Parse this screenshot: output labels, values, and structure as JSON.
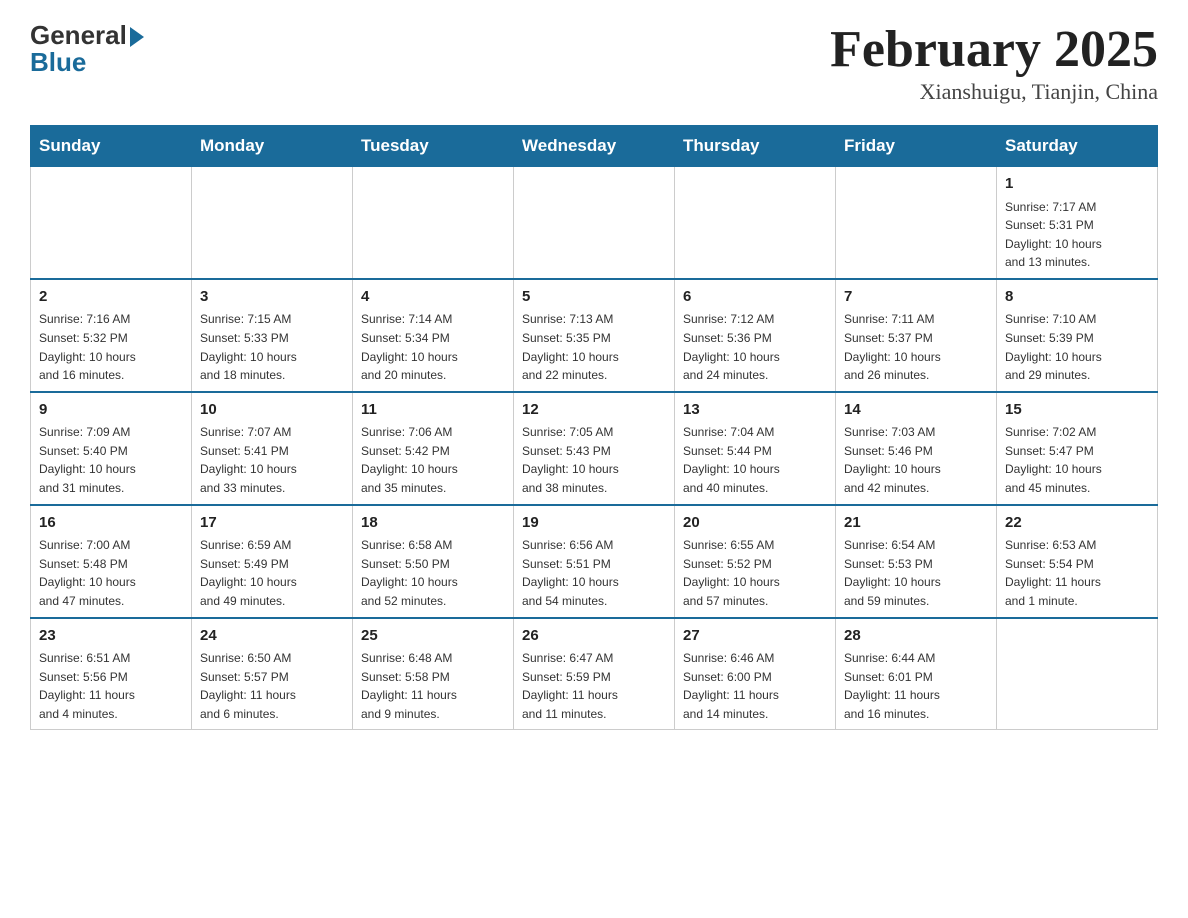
{
  "header": {
    "logo_general": "General",
    "logo_blue": "Blue",
    "month_title": "February 2025",
    "location": "Xianshuigu, Tianjin, China"
  },
  "days_of_week": [
    "Sunday",
    "Monday",
    "Tuesday",
    "Wednesday",
    "Thursday",
    "Friday",
    "Saturday"
  ],
  "weeks": [
    {
      "days": [
        {
          "num": "",
          "info": ""
        },
        {
          "num": "",
          "info": ""
        },
        {
          "num": "",
          "info": ""
        },
        {
          "num": "",
          "info": ""
        },
        {
          "num": "",
          "info": ""
        },
        {
          "num": "",
          "info": ""
        },
        {
          "num": "1",
          "info": "Sunrise: 7:17 AM\nSunset: 5:31 PM\nDaylight: 10 hours\nand 13 minutes."
        }
      ]
    },
    {
      "days": [
        {
          "num": "2",
          "info": "Sunrise: 7:16 AM\nSunset: 5:32 PM\nDaylight: 10 hours\nand 16 minutes."
        },
        {
          "num": "3",
          "info": "Sunrise: 7:15 AM\nSunset: 5:33 PM\nDaylight: 10 hours\nand 18 minutes."
        },
        {
          "num": "4",
          "info": "Sunrise: 7:14 AM\nSunset: 5:34 PM\nDaylight: 10 hours\nand 20 minutes."
        },
        {
          "num": "5",
          "info": "Sunrise: 7:13 AM\nSunset: 5:35 PM\nDaylight: 10 hours\nand 22 minutes."
        },
        {
          "num": "6",
          "info": "Sunrise: 7:12 AM\nSunset: 5:36 PM\nDaylight: 10 hours\nand 24 minutes."
        },
        {
          "num": "7",
          "info": "Sunrise: 7:11 AM\nSunset: 5:37 PM\nDaylight: 10 hours\nand 26 minutes."
        },
        {
          "num": "8",
          "info": "Sunrise: 7:10 AM\nSunset: 5:39 PM\nDaylight: 10 hours\nand 29 minutes."
        }
      ]
    },
    {
      "days": [
        {
          "num": "9",
          "info": "Sunrise: 7:09 AM\nSunset: 5:40 PM\nDaylight: 10 hours\nand 31 minutes."
        },
        {
          "num": "10",
          "info": "Sunrise: 7:07 AM\nSunset: 5:41 PM\nDaylight: 10 hours\nand 33 minutes."
        },
        {
          "num": "11",
          "info": "Sunrise: 7:06 AM\nSunset: 5:42 PM\nDaylight: 10 hours\nand 35 minutes."
        },
        {
          "num": "12",
          "info": "Sunrise: 7:05 AM\nSunset: 5:43 PM\nDaylight: 10 hours\nand 38 minutes."
        },
        {
          "num": "13",
          "info": "Sunrise: 7:04 AM\nSunset: 5:44 PM\nDaylight: 10 hours\nand 40 minutes."
        },
        {
          "num": "14",
          "info": "Sunrise: 7:03 AM\nSunset: 5:46 PM\nDaylight: 10 hours\nand 42 minutes."
        },
        {
          "num": "15",
          "info": "Sunrise: 7:02 AM\nSunset: 5:47 PM\nDaylight: 10 hours\nand 45 minutes."
        }
      ]
    },
    {
      "days": [
        {
          "num": "16",
          "info": "Sunrise: 7:00 AM\nSunset: 5:48 PM\nDaylight: 10 hours\nand 47 minutes."
        },
        {
          "num": "17",
          "info": "Sunrise: 6:59 AM\nSunset: 5:49 PM\nDaylight: 10 hours\nand 49 minutes."
        },
        {
          "num": "18",
          "info": "Sunrise: 6:58 AM\nSunset: 5:50 PM\nDaylight: 10 hours\nand 52 minutes."
        },
        {
          "num": "19",
          "info": "Sunrise: 6:56 AM\nSunset: 5:51 PM\nDaylight: 10 hours\nand 54 minutes."
        },
        {
          "num": "20",
          "info": "Sunrise: 6:55 AM\nSunset: 5:52 PM\nDaylight: 10 hours\nand 57 minutes."
        },
        {
          "num": "21",
          "info": "Sunrise: 6:54 AM\nSunset: 5:53 PM\nDaylight: 10 hours\nand 59 minutes."
        },
        {
          "num": "22",
          "info": "Sunrise: 6:53 AM\nSunset: 5:54 PM\nDaylight: 11 hours\nand 1 minute."
        }
      ]
    },
    {
      "days": [
        {
          "num": "23",
          "info": "Sunrise: 6:51 AM\nSunset: 5:56 PM\nDaylight: 11 hours\nand 4 minutes."
        },
        {
          "num": "24",
          "info": "Sunrise: 6:50 AM\nSunset: 5:57 PM\nDaylight: 11 hours\nand 6 minutes."
        },
        {
          "num": "25",
          "info": "Sunrise: 6:48 AM\nSunset: 5:58 PM\nDaylight: 11 hours\nand 9 minutes."
        },
        {
          "num": "26",
          "info": "Sunrise: 6:47 AM\nSunset: 5:59 PM\nDaylight: 11 hours\nand 11 minutes."
        },
        {
          "num": "27",
          "info": "Sunrise: 6:46 AM\nSunset: 6:00 PM\nDaylight: 11 hours\nand 14 minutes."
        },
        {
          "num": "28",
          "info": "Sunrise: 6:44 AM\nSunset: 6:01 PM\nDaylight: 11 hours\nand 16 minutes."
        },
        {
          "num": "",
          "info": ""
        }
      ]
    }
  ]
}
